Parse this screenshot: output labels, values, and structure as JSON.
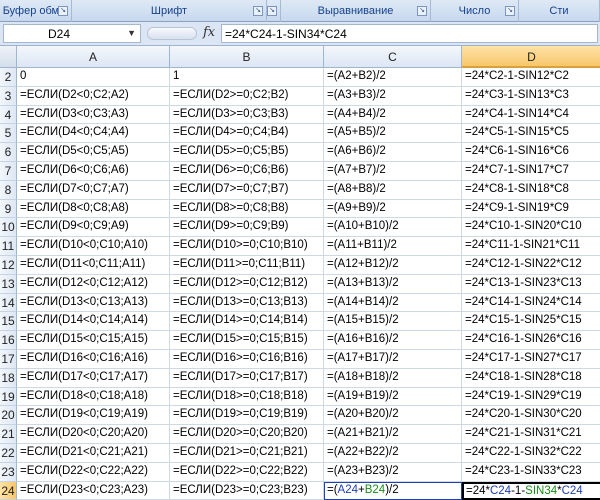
{
  "ribbon": {
    "groups": [
      {
        "label": "Буфер обм...",
        "launcher": "↘"
      },
      {
        "label": "Шрифт",
        "launcher": "↘"
      },
      {
        "label": "",
        "launcher": "↘"
      },
      {
        "label": "Выравнивание",
        "launcher": "↘"
      },
      {
        "label": "Число",
        "launcher": "↘"
      },
      {
        "label": "Сти",
        "launcher": ""
      }
    ]
  },
  "formula_bar": {
    "name_box": "D24",
    "formula": "=24*C24-1-SIN34*C24",
    "fx_label": "fx"
  },
  "columns": [
    "A",
    "B",
    "C",
    "D"
  ],
  "active_column": "D",
  "active_row": "24",
  "rows": [
    {
      "n": "2",
      "a": "0",
      "b": "1",
      "c": "=(A2+B2)/2",
      "d": "=24*C2-1-SIN12*C2"
    },
    {
      "n": "3",
      "a": "=ЕСЛИ(D2<0;C2;A2)",
      "b": "=ЕСЛИ(D2>=0;C2;B2)",
      "c": "=(A3+B3)/2",
      "d": "=24*C3-1-SIN13*C3"
    },
    {
      "n": "4",
      "a": "=ЕСЛИ(D3<0;C3;A3)",
      "b": "=ЕСЛИ(D3>=0;C3;B3)",
      "c": "=(A4+B4)/2",
      "d": "=24*C4-1-SIN14*C4"
    },
    {
      "n": "5",
      "a": "=ЕСЛИ(D4<0;C4;A4)",
      "b": "=ЕСЛИ(D4>=0;C4;B4)",
      "c": "=(A5+B5)/2",
      "d": "=24*C5-1-SIN15*C5"
    },
    {
      "n": "6",
      "a": "=ЕСЛИ(D5<0;C5;A5)",
      "b": "=ЕСЛИ(D5>=0;C5;B5)",
      "c": "=(A6+B6)/2",
      "d": "=24*C6-1-SIN16*C6"
    },
    {
      "n": "7",
      "a": "=ЕСЛИ(D6<0;C6;A6)",
      "b": "=ЕСЛИ(D6>=0;C6;B6)",
      "c": "=(A7+B7)/2",
      "d": "=24*C7-1-SIN17*C7"
    },
    {
      "n": "8",
      "a": "=ЕСЛИ(D7<0;C7;A7)",
      "b": "=ЕСЛИ(D7>=0;C7;B7)",
      "c": "=(A8+B8)/2",
      "d": "=24*C8-1-SIN18*C8"
    },
    {
      "n": "9",
      "a": "=ЕСЛИ(D8<0;C8;A8)",
      "b": "=ЕСЛИ(D8>=0;C8;B8)",
      "c": "=(A9+B9)/2",
      "d": "=24*C9-1-SIN19*C9"
    },
    {
      "n": "10",
      "a": "=ЕСЛИ(D9<0;C9;A9)",
      "b": "=ЕСЛИ(D9>=0;C9;B9)",
      "c": "=(A10+B10)/2",
      "d": "=24*C10-1-SIN20*C10"
    },
    {
      "n": "11",
      "a": "=ЕСЛИ(D10<0;C10;A10)",
      "b": "=ЕСЛИ(D10>=0;C10;B10)",
      "c": "=(A11+B11)/2",
      "d": "=24*C11-1-SIN21*C11"
    },
    {
      "n": "12",
      "a": "=ЕСЛИ(D11<0;C11;A11)",
      "b": "=ЕСЛИ(D11>=0;C11;B11)",
      "c": "=(A12+B12)/2",
      "d": "=24*C12-1-SIN22*C12"
    },
    {
      "n": "13",
      "a": "=ЕСЛИ(D12<0;C12;A12)",
      "b": "=ЕСЛИ(D12>=0;C12;B12)",
      "c": "=(A13+B13)/2",
      "d": "=24*C13-1-SIN23*C13"
    },
    {
      "n": "14",
      "a": "=ЕСЛИ(D13<0;C13;A13)",
      "b": "=ЕСЛИ(D13>=0;C13;B13)",
      "c": "=(A14+B14)/2",
      "d": "=24*C14-1-SIN24*C14"
    },
    {
      "n": "15",
      "a": "=ЕСЛИ(D14<0;C14;A14)",
      "b": "=ЕСЛИ(D14>=0;C14;B14)",
      "c": "=(A15+B15)/2",
      "d": "=24*C15-1-SIN25*C15"
    },
    {
      "n": "16",
      "a": "=ЕСЛИ(D15<0;C15;A15)",
      "b": "=ЕСЛИ(D15>=0;C15;B15)",
      "c": "=(A16+B16)/2",
      "d": "=24*C16-1-SIN26*C16"
    },
    {
      "n": "17",
      "a": "=ЕСЛИ(D16<0;C16;A16)",
      "b": "=ЕСЛИ(D16>=0;C16;B16)",
      "c": "=(A17+B17)/2",
      "d": "=24*C17-1-SIN27*C17"
    },
    {
      "n": "18",
      "a": "=ЕСЛИ(D17<0;C17;A17)",
      "b": "=ЕСЛИ(D17>=0;C17;B17)",
      "c": "=(A18+B18)/2",
      "d": "=24*C18-1-SIN28*C18"
    },
    {
      "n": "19",
      "a": "=ЕСЛИ(D18<0;C18;A18)",
      "b": "=ЕСЛИ(D18>=0;C18;B18)",
      "c": "=(A19+B19)/2",
      "d": "=24*C19-1-SIN29*C19"
    },
    {
      "n": "20",
      "a": "=ЕСЛИ(D19<0;C19;A19)",
      "b": "=ЕСЛИ(D19>=0;C19;B19)",
      "c": "=(A20+B20)/2",
      "d": "=24*C20-1-SIN30*C20"
    },
    {
      "n": "21",
      "a": "=ЕСЛИ(D20<0;C20;A20)",
      "b": "=ЕСЛИ(D20>=0;C20;B20)",
      "c": "=(A21+B21)/2",
      "d": "=24*C21-1-SIN31*C21"
    },
    {
      "n": "22",
      "a": "=ЕСЛИ(D21<0;C21;A21)",
      "b": "=ЕСЛИ(D21>=0;C21;B21)",
      "c": "=(A22+B22)/2",
      "d": "=24*C22-1-SIN32*C22"
    },
    {
      "n": "23",
      "a": "=ЕСЛИ(D22<0;C22;A22)",
      "b": "=ЕСЛИ(D22>=0;C22;B22)",
      "c": "=(A23+B23)/2",
      "d": "=24*C23-1-SIN33*C23"
    },
    {
      "n": "24",
      "a": "=ЕСЛИ(D23<0;C23;A23)",
      "b": "=ЕСЛИ(D23>=0;C23;B23)",
      "c": "=(A24+B24)/2",
      "d": "=24*C24-1-SIN34*C24"
    }
  ],
  "colors": {
    "ref_blue": "#1f3fb5",
    "ref_green": "#1a8c1a",
    "ref_purple": "#7a2ca0",
    "active_header": "#f9c76a"
  }
}
